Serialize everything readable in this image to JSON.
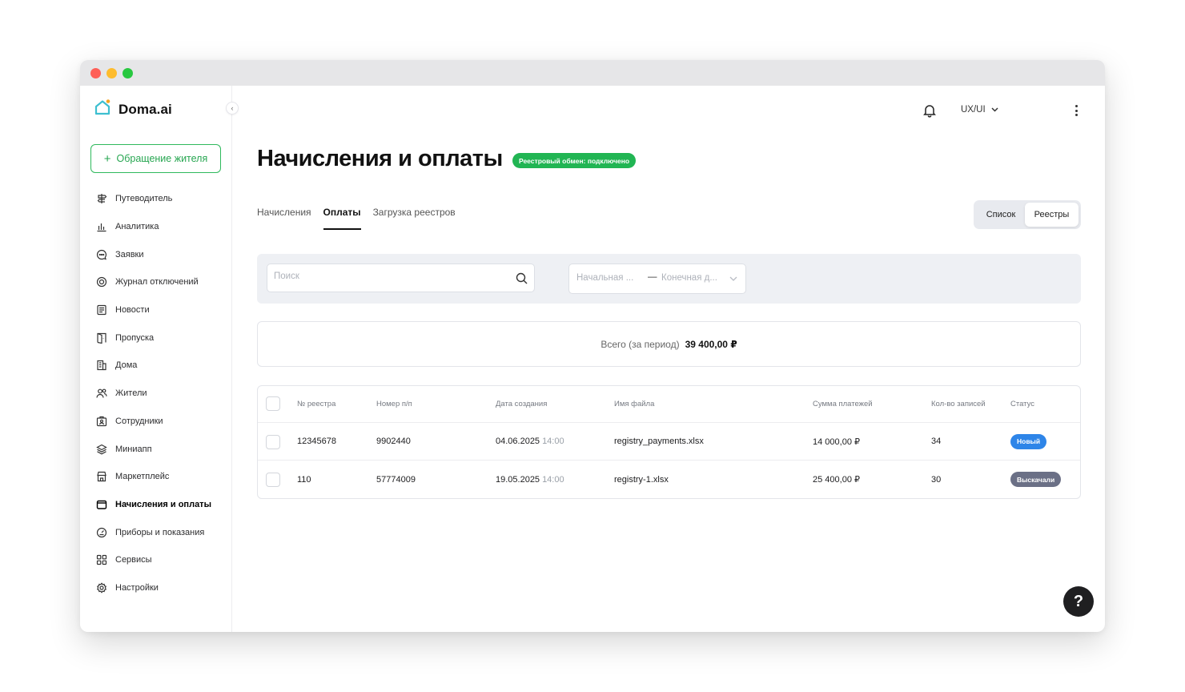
{
  "app": {
    "name": "Doma.ai"
  },
  "sidebar": {
    "appeal_button": "Обращение жителя",
    "items": [
      {
        "label": "Путеводитель",
        "icon": "signpost-icon"
      },
      {
        "label": "Аналитика",
        "icon": "bar-chart-icon"
      },
      {
        "label": "Заявки",
        "icon": "chat-bubble-icon"
      },
      {
        "label": "Журнал отключений",
        "icon": "disconnect-log-icon"
      },
      {
        "label": "Новости",
        "icon": "newspaper-icon"
      },
      {
        "label": "Пропуска",
        "icon": "door-pass-icon"
      },
      {
        "label": "Дома",
        "icon": "building-icon"
      },
      {
        "label": "Жители",
        "icon": "residents-icon"
      },
      {
        "label": "Сотрудники",
        "icon": "employee-badge-icon"
      },
      {
        "label": "Миниапп",
        "icon": "layers-icon"
      },
      {
        "label": "Маркетплейс",
        "icon": "store-icon"
      },
      {
        "label": "Начисления и оплаты",
        "icon": "wallet-icon",
        "active": true
      },
      {
        "label": "Приборы и показания",
        "icon": "meter-icon"
      },
      {
        "label": "Сервисы",
        "icon": "grid-icon"
      },
      {
        "label": "Настройки",
        "icon": "gear-icon"
      }
    ]
  },
  "header": {
    "user": "UX/UI"
  },
  "page": {
    "title": "Начисления и оплаты",
    "status_pill": "Реестровый обмен: подключено",
    "tabs": [
      "Начисления",
      "Оплаты",
      "Загрузка реестров"
    ],
    "active_tab": "Оплаты",
    "view_toggle": {
      "list": "Список",
      "registries": "Реестры",
      "selected": "Реестры"
    }
  },
  "filters": {
    "search_placeholder": "Поиск",
    "date_start_placeholder": "Начальная ...",
    "date_end_placeholder": "Конечная д...",
    "date_separator": "—"
  },
  "summary": {
    "label": "Всего (за период)",
    "value": "39 400,00 ₽"
  },
  "table": {
    "headers": [
      "№ реестра",
      "Номер п/п",
      "Дата создания",
      "Имя файла",
      "Сумма платежей",
      "Кол-во записей",
      "Статус"
    ],
    "rows": [
      {
        "registry_no": "12345678",
        "pp_no": "9902440",
        "date": "04.06.2025",
        "time": "14:00",
        "file": "registry_payments.xlsx",
        "amount": "14 000,00 ₽",
        "count": "34",
        "status": "Новый",
        "status_color": "#2e85e8"
      },
      {
        "registry_no": "110",
        "pp_no": "57774009",
        "date": "19.05.2025",
        "time": "14:00",
        "file": "registry-1.xlsx",
        "amount": "25 400,00 ₽",
        "count": "30",
        "status": "Выскачали",
        "status_color": "#6b7086"
      }
    ]
  },
  "help": {
    "label": "?"
  },
  "colors": {
    "accent_green": "#21b553",
    "badge_new": "#2e85e8",
    "badge_downloaded": "#6b7086"
  }
}
